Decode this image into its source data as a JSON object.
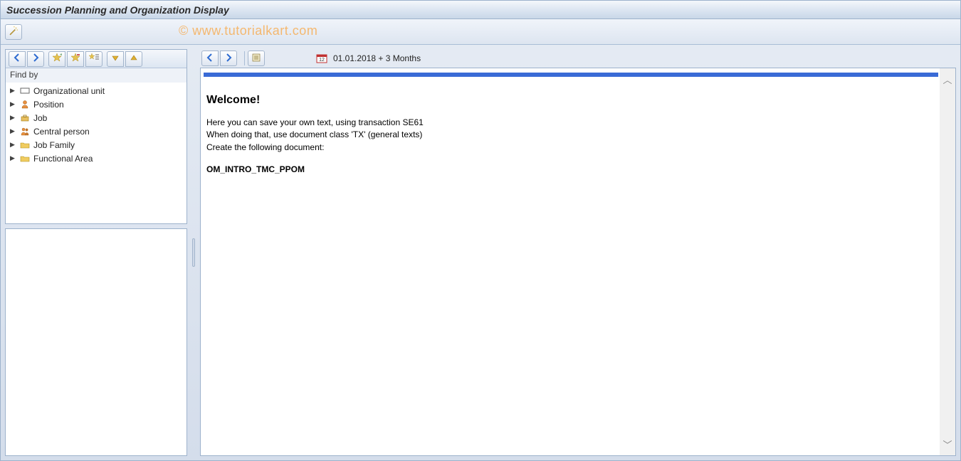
{
  "title": "Succession Planning and Organization Display",
  "watermark": "© www.tutorialkart.com",
  "app_toolbar": {
    "wand": "wand-icon"
  },
  "left": {
    "toolbar": {
      "back": "back",
      "forward": "forward",
      "star_add": "star-add",
      "star_del": "star-del",
      "star_list": "star-list",
      "tri_down": "expand",
      "tri_up": "collapse"
    },
    "find_label": "Find by",
    "tree": [
      {
        "label": "Organizational unit",
        "icon": "org-unit"
      },
      {
        "label": "Position",
        "icon": "person"
      },
      {
        "label": "Job",
        "icon": "job"
      },
      {
        "label": "Central person",
        "icon": "central-person"
      },
      {
        "label": "Job Family",
        "icon": "folder"
      },
      {
        "label": "Functional Area",
        "icon": "folder"
      }
    ]
  },
  "right": {
    "toolbar": {
      "back": "back",
      "forward": "forward",
      "details": "details"
    },
    "date_text": "01.01.2018  + 3 Months",
    "doc": {
      "heading": "Welcome!",
      "line1": "Here you can save your own text, using transaction SE61",
      "line2": "When doing that, use document class 'TX' (general texts)",
      "line3": "Create the following document:",
      "docname": "OM_INTRO_TMC_PPOM"
    }
  }
}
